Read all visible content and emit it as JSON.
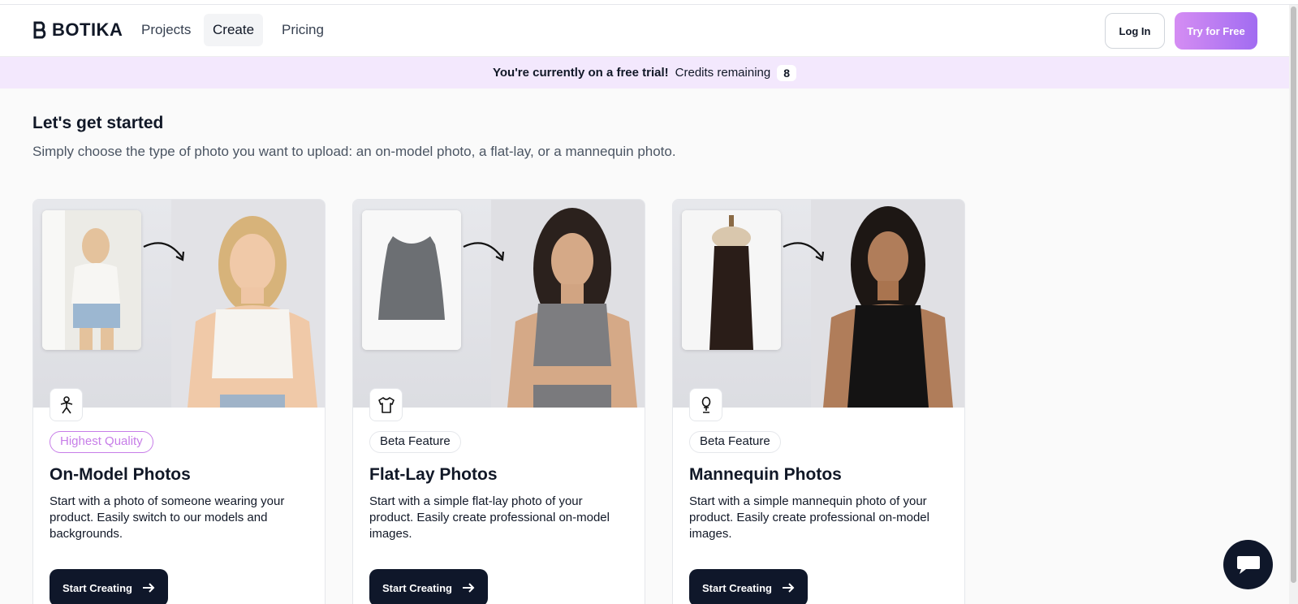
{
  "nav": {
    "logo_text": "BOTIKA",
    "links": [
      {
        "label": "Projects"
      },
      {
        "label": "Create"
      },
      {
        "label": "Pricing"
      }
    ],
    "login_label": "Log In",
    "try_label": "Try for Free"
  },
  "banner": {
    "trial_text": "You're currently on a free trial!",
    "credits_label": "Credits remaining",
    "credits_count": "8"
  },
  "main": {
    "heading": "Let's get started",
    "subheading": "Simply choose the type of photo you want to upload: an on-model photo, a flat-lay, or a mannequin photo."
  },
  "cards": [
    {
      "icon": "person-icon",
      "badge": "Highest Quality",
      "title": "On-Model Photos",
      "description": "Start with a photo of someone wearing your product. Easily switch to our models and backgrounds.",
      "button": "Start Creating"
    },
    {
      "icon": "tshirt-icon",
      "badge": "Beta Feature",
      "title": "Flat-Lay Photos",
      "description": "Start with a simple flat-lay photo of your product. Easily create professional on-model images.",
      "button": "Start Creating"
    },
    {
      "icon": "mannequin-icon",
      "badge": "Beta Feature",
      "title": "Mannequin Photos",
      "description": "Start with a simple mannequin photo of your product. Easily create professional on-model images.",
      "button": "Start Creating"
    }
  ],
  "colors": {
    "brand_gradient_start": "#d58df3",
    "brand_gradient_end": "#a16cf1",
    "banner_bg": "#f3e8fd",
    "dark_button": "#0f172a",
    "badge_highlight": "#c77de8"
  }
}
